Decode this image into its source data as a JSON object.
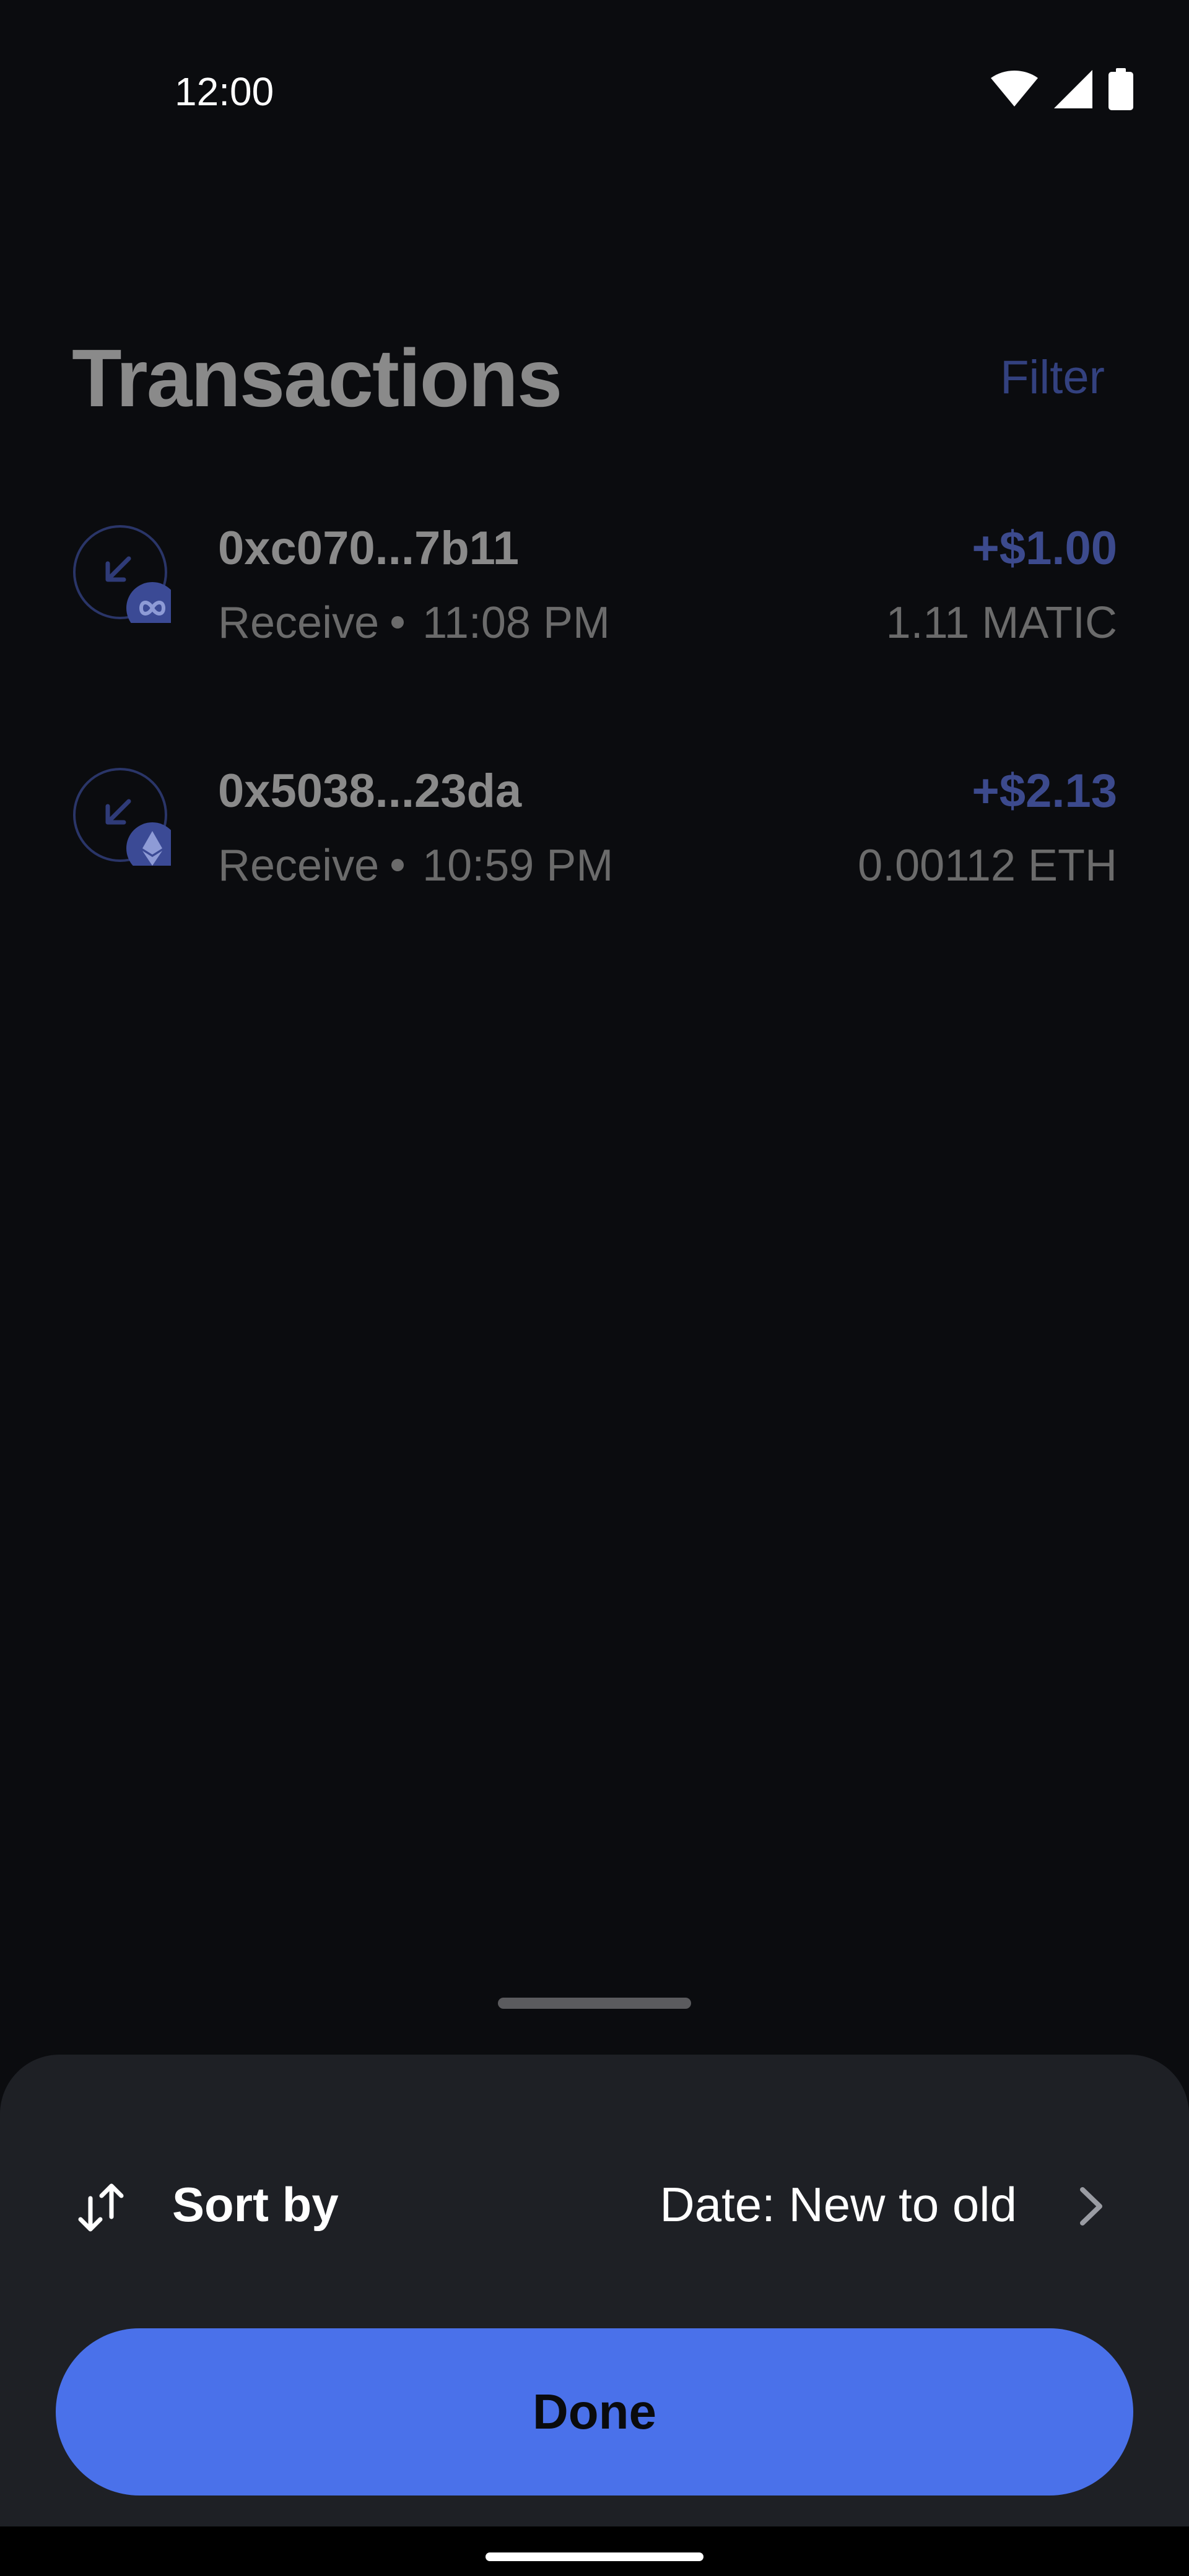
{
  "status_bar": {
    "time": "12:00",
    "icons": [
      "wifi-icon",
      "signal-icon",
      "battery-icon"
    ]
  },
  "page": {
    "title": "Transactions",
    "filter_label": "Filter",
    "transactions": [
      {
        "address": "0xc070...7b11",
        "type": "Receive",
        "time": "11:08 PM",
        "amount": "+$1.00",
        "crypto_amount": "1.11 MATIC",
        "icon": "polygon-icon"
      },
      {
        "address": "0x5038...23da",
        "type": "Receive",
        "time": "10:59 PM",
        "amount": "+$2.13",
        "crypto_amount": "0.00112 ETH",
        "icon": "ethereum-icon"
      }
    ]
  },
  "sheet": {
    "sort_label": "Sort by",
    "sort_value": "Date: New to old",
    "done_label": "Done"
  },
  "colors": {
    "background": "#0b0c0f",
    "sheet": "#1e2025",
    "accent": "#4a71ea",
    "dim_accent": "#3c4a8d"
  }
}
